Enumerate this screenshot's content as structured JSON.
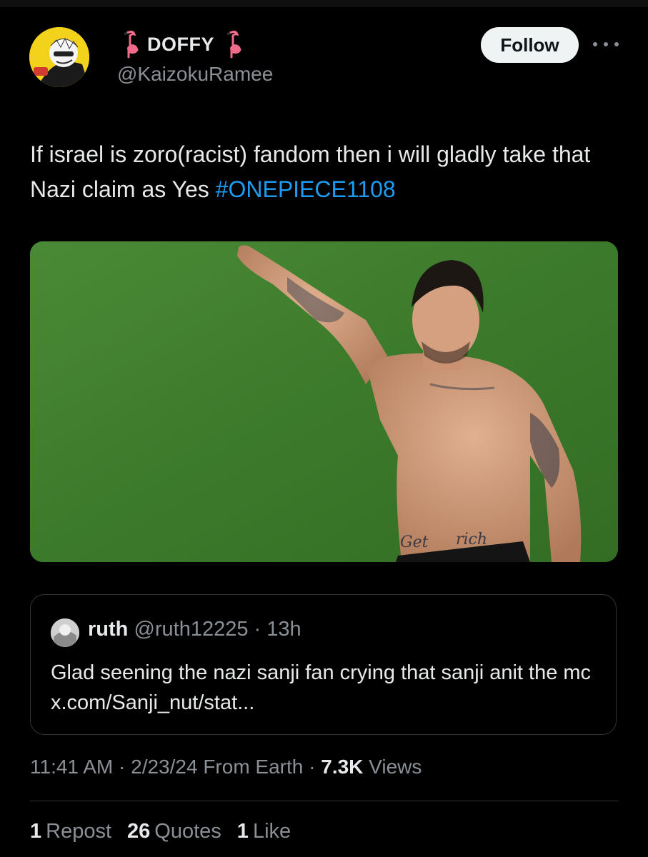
{
  "author": {
    "display_name": "DOFFY",
    "handle": "@KaizokuRamee",
    "name_emoji_left": "flamingo-icon",
    "name_emoji_right": "flamingo-icon"
  },
  "follow_label": "Follow",
  "tweet": {
    "text": "If israel is zoro(racist) fandom then i will gladly take that Nazi claim as Yes ",
    "hashtag": "#ONEPIECE1108"
  },
  "media": {
    "tattoo_text_1": "Get",
    "tattoo_text_2": "rich"
  },
  "quote": {
    "name": "ruth",
    "handle": "@ruth12225",
    "separator": " · ",
    "time": "13h",
    "text": "Glad seening the nazi sanji fan crying that sanji anit the mc x.com/Sanji_nut/stat..."
  },
  "meta": {
    "time": "11:41 AM",
    "dot1": " · ",
    "date": "2/23/24",
    "source": " From Earth",
    "dot2": " · ",
    "views_count": "7.3K",
    "views_label": " Views"
  },
  "stats": {
    "reposts_count": "1",
    "reposts_label": "Repost",
    "quotes_count": "26",
    "quotes_label": "Quotes",
    "likes_count": "1",
    "likes_label": "Like"
  },
  "colors": {
    "background": "#000000",
    "text": "#e7e9ea",
    "secondary": "#8b9096",
    "link": "#1d9bf0",
    "border": "#2f3336",
    "follow_bg": "#eff3f4",
    "avatar_bg": "#f2d21b"
  }
}
